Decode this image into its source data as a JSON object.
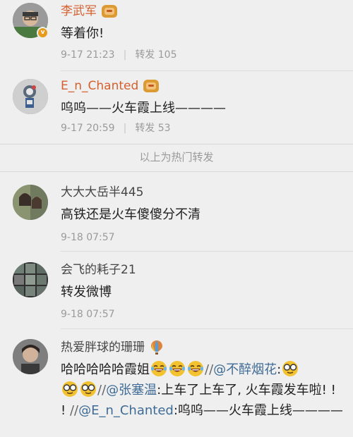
{
  "hot_label": "以上为热门转发",
  "reposts": [
    {
      "username": "李武军",
      "has_crown": true,
      "verified_badge": "v",
      "text": "等着你!",
      "date": "9-17",
      "time": "21:23",
      "repost_label": "转发",
      "repost_count": "105"
    },
    {
      "username": "E_n_Chanted",
      "has_crown": true,
      "text": "呜呜——火车霞上线————",
      "date": "9-17",
      "time": "20:59",
      "repost_label": "转发",
      "repost_count": "53"
    },
    {
      "username": "大大大岳半445",
      "text": "高铁还是火车傻傻分不清",
      "date": "9-18",
      "time": "07:57"
    },
    {
      "username": "会飞的耗子21",
      "text": "转发微博",
      "date": "9-18",
      "time": "07:57"
    },
    {
      "username": "热爱胖球的珊珊",
      "icon": "hot-air-balloon-icon",
      "text_parts": {
        "t1": "哈哈哈哈哈霞姐",
        "sep1": "//",
        "mention1": "@不醉烟花",
        "colon1": ":",
        "sep2": "//",
        "mention2": "@张塞温",
        "t2": ":上车了上车了, 火车霞发车啦! ! ! ",
        "sep3": "//",
        "mention3": "@E_n_Chanted",
        "t3": ":呜呜——火车霞上线————"
      }
    }
  ],
  "colors": {
    "background": "#efefef",
    "vip_name": "#d4602e",
    "mention": "#3f6c96",
    "meta_text": "#9a9a9a",
    "crown": "#dc9a33"
  }
}
